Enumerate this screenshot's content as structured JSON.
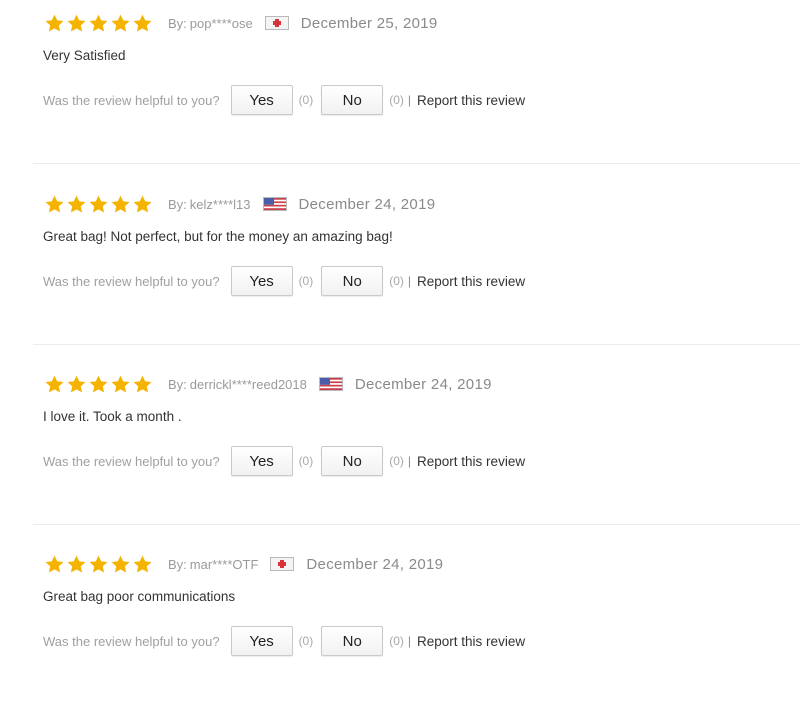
{
  "reviews": [
    {
      "rating": 5,
      "by_label": "By:",
      "reviewer": "pop****ose",
      "flag": "red-cross-flag-icon",
      "date": "December 25, 2019",
      "text": "Very Satisfied",
      "helpful_question": "Was the review helpful to you?",
      "yes_label": "Yes",
      "yes_count": "(0)",
      "no_label": "No",
      "no_count": "(0)",
      "separator": "|",
      "report_label": "Report this review"
    },
    {
      "rating": 5,
      "by_label": "By:",
      "reviewer": "kelz****l13",
      "flag": "us-flag-icon",
      "date": "December 24, 2019",
      "text": "Great bag! Not perfect, but for the money an amazing bag!",
      "helpful_question": "Was the review helpful to you?",
      "yes_label": "Yes",
      "yes_count": "(0)",
      "no_label": "No",
      "no_count": "(0)",
      "separator": "|",
      "report_label": "Report this review"
    },
    {
      "rating": 5,
      "by_label": "By:",
      "reviewer": "derrickl****reed2018",
      "flag": "us-flag-icon",
      "date": "December 24, 2019",
      "text": "I love it. Took a month .",
      "helpful_question": "Was the review helpful to you?",
      "yes_label": "Yes",
      "yes_count": "(0)",
      "no_label": "No",
      "no_count": "(0)",
      "separator": "|",
      "report_label": "Report this review"
    },
    {
      "rating": 5,
      "by_label": "By:",
      "reviewer": "mar****OTF",
      "flag": "red-cross-flag-icon",
      "date": "December 24, 2019",
      "text": "Great bag poor communications",
      "helpful_question": "Was the review helpful to you?",
      "yes_label": "Yes",
      "yes_count": "(0)",
      "no_label": "No",
      "no_count": "(0)",
      "separator": "|",
      "report_label": "Report this review"
    }
  ],
  "colors": {
    "star": "#f5b301",
    "divider": "#ececec",
    "muted_text": "#9a9a9a",
    "body_text": "#333333"
  }
}
